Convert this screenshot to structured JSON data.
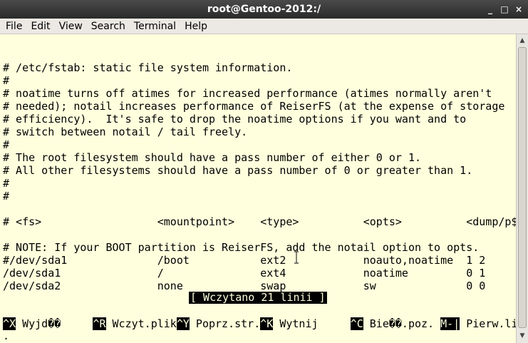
{
  "window": {
    "title": "root@Gentoo-2012:/",
    "controls": {
      "minimize": "_",
      "maximize": "□",
      "close": "×"
    }
  },
  "menu": [
    "File",
    "Edit",
    "View",
    "Search",
    "Terminal",
    "Help"
  ],
  "terminal": {
    "lines": [
      "",
      "# /etc/fstab: static file system information.",
      "#",
      "# noatime turns off atimes for increased performance (atimes normally aren't",
      "# needed); notail increases performance of ReiserFS (at the expense of storage",
      "# efficiency).  It's safe to drop the noatime options if you want and to",
      "# switch between notail / tail freely.",
      "#",
      "# The root filesystem should have a pass number of either 0 or 1.",
      "# All other filesystems should have a pass number of 0 or greater than 1.",
      "#",
      "#",
      "",
      "# <fs>                  <mountpoint>    <type>          <opts>          <dump/p$",
      "",
      "# NOTE: If your BOOT partition is ReiserFS, add the notail option to opts.",
      "#/dev/sda1              /boot           ext2            noauto,noatime  1 2",
      "/dev/sda1               /               ext4            noatime         0 1",
      "/dev/sda2               none            swap            sw              0 0"
    ],
    "status_message": "[ Wczytano 21 linii ]",
    "shortcuts": [
      {
        "key": "^X",
        "label": " Wyjd��     "
      },
      {
        "key": "^R",
        "label": " Wczyt.plik"
      },
      {
        "key": "^Y",
        "label": " Poprz.str."
      },
      {
        "key": "^K",
        "label": " Wytnij     "
      },
      {
        "key": "^C",
        "label": " Bie��.poz. "
      },
      {
        "key": "M-|",
        "label": " Pierw.lin"
      }
    ],
    "last_line": "."
  }
}
